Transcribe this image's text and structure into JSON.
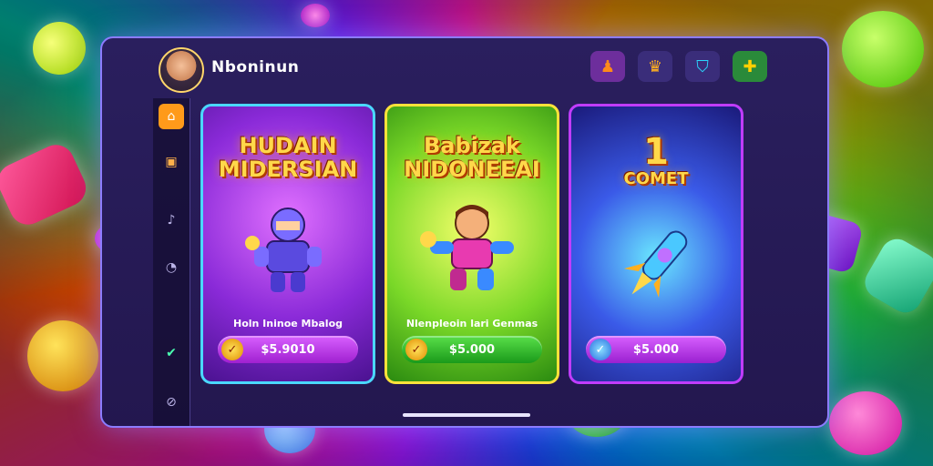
{
  "header": {
    "brand_name": "Nboninun",
    "avatar_icon": "player-avatar-icon",
    "top_buttons": [
      {
        "icon": "user-icon",
        "glyph": "♟",
        "color": "#ff8a1a",
        "bg": "#6d2e9c"
      },
      {
        "icon": "crown-icon",
        "glyph": "♛",
        "color": "#ffb020",
        "bg": "#3a2d7a"
      },
      {
        "icon": "shield-icon",
        "glyph": "⛉",
        "color": "#2ad8ff",
        "bg": "#3a2d7a"
      },
      {
        "icon": "puzzle-icon",
        "glyph": "✚",
        "color": "#ffd000",
        "bg": "#2a8a3a"
      }
    ]
  },
  "sidebar": {
    "items": [
      {
        "icon": "home-icon",
        "glyph": "⌂",
        "active": true
      },
      {
        "icon": "game-icon",
        "glyph": "▣"
      },
      {
        "icon": "bell-icon",
        "glyph": "♪"
      },
      {
        "icon": "history-icon",
        "glyph": "◔"
      },
      {
        "icon": "check-icon",
        "glyph": "✔"
      },
      {
        "icon": "settings-icon",
        "glyph": "⊘"
      }
    ]
  },
  "cards": [
    {
      "title_line1": "HUDAIN",
      "title_line2": "MIDERSIAN",
      "subtitle": "Holn Ininoe Mbalog",
      "price": "$5.9010",
      "bg": "#7a2ad0",
      "border": "#4ad8ff",
      "button_bg": "#c23cf0",
      "hero_icon": "knight-icon",
      "hero_color": "#7a6cff"
    },
    {
      "title_line1": "Babizak",
      "title_line2": "NIDONEEAI",
      "subtitle": "Nlenpleoin lari Genmas",
      "price": "$5.000",
      "bg": "#5acc28",
      "border": "#ffe23a",
      "button_bg": "#3ab83a",
      "hero_icon": "hero-icon",
      "hero_color": "#e83ab0"
    },
    {
      "title_line1": "1",
      "title_line2": "COMET",
      "subtitle": "",
      "price": "$5.000",
      "bg": "#2a38c8",
      "border": "#c03cff",
      "button_bg": "#b03ce0",
      "hero_icon": "rocket-icon",
      "hero_color": "#4ac8ff"
    }
  ]
}
